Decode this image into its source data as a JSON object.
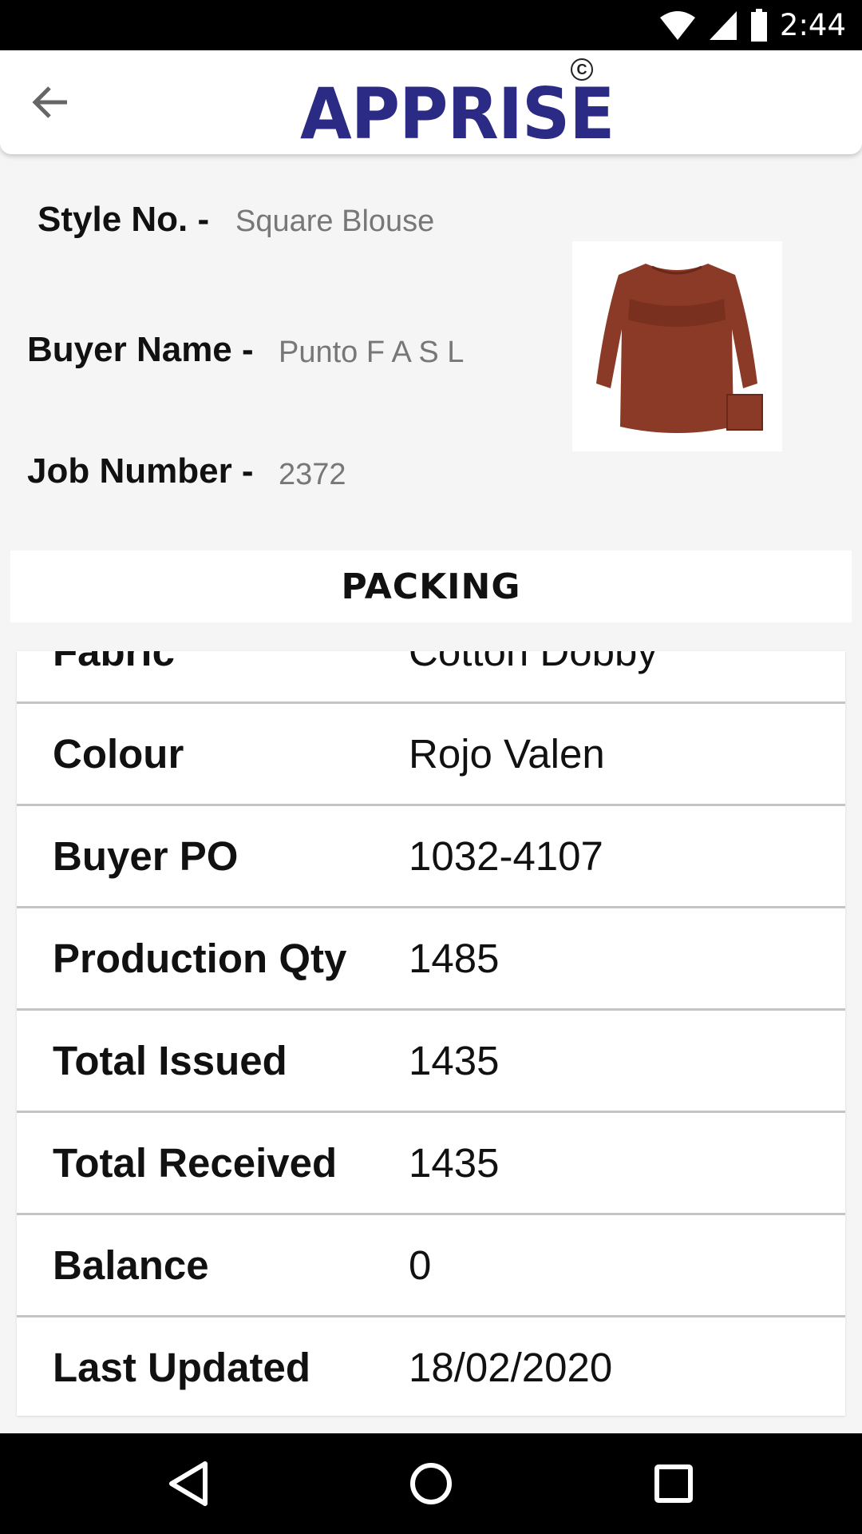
{
  "status_bar": {
    "time": "2:44",
    "icons": [
      "wifi-icon",
      "signal-icon",
      "battery-icon"
    ]
  },
  "app_bar": {
    "logo_text": "APPRISE",
    "copyright_symbol": "C"
  },
  "info": {
    "style_label": "Style No. -",
    "style_value": "Square Blouse",
    "buyer_label": "Buyer Name -",
    "buyer_value": "Punto F A S L",
    "job_label": "Job Number -",
    "job_value": "2372"
  },
  "section_title": "PACKING",
  "table": {
    "rows": [
      {
        "label": "Fabric",
        "value": "Cotton Dobby"
      },
      {
        "label": "Colour",
        "value": "Rojo Valen"
      },
      {
        "label": "Buyer PO",
        "value": "1032-4107"
      },
      {
        "label": "Production Qty",
        "value": "1485"
      },
      {
        "label": "Total Issued",
        "value": "1435"
      },
      {
        "label": "Total Received",
        "value": "1435"
      },
      {
        "label": "Balance",
        "value": "0"
      },
      {
        "label": "Last Updated",
        "value": "18/02/2020"
      }
    ]
  },
  "colors": {
    "brand": "#2b2a85",
    "product": "#8a3a26"
  }
}
